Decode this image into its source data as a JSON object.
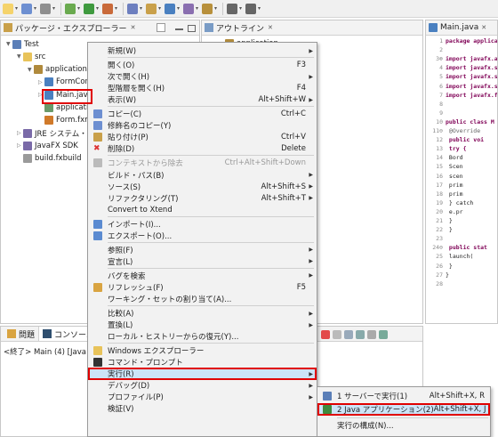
{
  "toolbar": {
    "icons": [
      "new-icon",
      "save-icon",
      "print-icon",
      "debug-icon",
      "run-icon",
      "external-tools-icon",
      "new-java-project-icon",
      "new-package-icon",
      "new-class-icon",
      "search-icon",
      "open-type-icon",
      "back-icon",
      "forward-icon"
    ]
  },
  "explorer": {
    "title": "パッケージ・エクスプローラー",
    "close": "✕",
    "tree": [
      {
        "label": "Test",
        "depth": 0,
        "twisty": "▼",
        "icon": "project"
      },
      {
        "label": "src",
        "depth": 1,
        "twisty": "▼",
        "icon": "folder"
      },
      {
        "label": "application",
        "depth": 2,
        "twisty": "▼",
        "icon": "package"
      },
      {
        "label": "FormCont",
        "depth": 3,
        "twisty": "▷",
        "icon": "java"
      },
      {
        "label": "Main.java",
        "depth": 3,
        "twisty": "▷",
        "icon": "java"
      },
      {
        "label": "applicatio",
        "depth": 3,
        "twisty": "",
        "icon": "css"
      },
      {
        "label": "Form.fxm",
        "depth": 3,
        "twisty": "",
        "icon": "fxml"
      },
      {
        "label": "JRE システム・ラ",
        "depth": 1,
        "twisty": "▷",
        "icon": "library"
      },
      {
        "label": "JavaFX SDK",
        "depth": 1,
        "twisty": "▷",
        "icon": "library"
      },
      {
        "label": "build.fxbuild",
        "depth": 1,
        "twisty": "",
        "icon": "file"
      }
    ]
  },
  "outline": {
    "title": "アウトライン",
    "close": "✕",
    "item": "application"
  },
  "editor": {
    "tab": "Main.java",
    "close": "✕",
    "lines": [
      {
        "n": "1",
        "text": "package applica"
      },
      {
        "n": "2",
        "text": ""
      },
      {
        "n": "3⊕",
        "text": "import javafx.a"
      },
      {
        "n": "4",
        "text": "import javafx.s"
      },
      {
        "n": "5",
        "text": "import javafx.s"
      },
      {
        "n": "6",
        "text": "import javafx.s"
      },
      {
        "n": "7",
        "text": "import javafx.f"
      },
      {
        "n": "8",
        "text": ""
      },
      {
        "n": "9",
        "text": ""
      },
      {
        "n": "10",
        "text": "public class M"
      },
      {
        "n": "11⊖",
        "text": "  @Override"
      },
      {
        "n": "12",
        "text": "  public voi"
      },
      {
        "n": "13",
        "text": "    try {"
      },
      {
        "n": "14",
        "text": "      Bord"
      },
      {
        "n": "15",
        "text": "      Scen"
      },
      {
        "n": "16",
        "text": "      scen"
      },
      {
        "n": "17",
        "text": "      prim"
      },
      {
        "n": "18",
        "text": "      prim"
      },
      {
        "n": "19",
        "text": "    } catch"
      },
      {
        "n": "20",
        "text": "      e.pr"
      },
      {
        "n": "21",
        "text": "    }"
      },
      {
        "n": "22",
        "text": "  }"
      },
      {
        "n": "23",
        "text": ""
      },
      {
        "n": "24⊖",
        "text": "  public stat"
      },
      {
        "n": "25",
        "text": "    launch("
      },
      {
        "n": "26",
        "text": "  }"
      },
      {
        "n": "27",
        "text": "}"
      },
      {
        "n": "28",
        "text": ""
      }
    ]
  },
  "console": {
    "tab_problems": "問題",
    "tab_console": "コンソール",
    "close": "✕",
    "line": "<終了> Main (4) [Java アプ"
  },
  "context_menu": {
    "items": [
      {
        "label": "新規(W)",
        "shortcut": "",
        "arrow": "▶",
        "icon": ""
      },
      {
        "sep": true
      },
      {
        "label": "開く(O)",
        "shortcut": "F3",
        "arrow": "",
        "icon": ""
      },
      {
        "label": "次で開く(H)",
        "shortcut": "",
        "arrow": "▶",
        "icon": ""
      },
      {
        "label": "型階層を開く(H)",
        "shortcut": "F4",
        "arrow": "",
        "icon": ""
      },
      {
        "label": "表示(W)",
        "shortcut": "Alt+Shift+W",
        "arrow": "▶",
        "icon": ""
      },
      {
        "sep": true
      },
      {
        "label": "コピー(C)",
        "shortcut": "Ctrl+C",
        "arrow": "",
        "icon": "copy"
      },
      {
        "label": "修飾名のコピー(Y)",
        "shortcut": "",
        "arrow": "",
        "icon": "copy"
      },
      {
        "label": "貼り付け(P)",
        "shortcut": "Ctrl+V",
        "arrow": "",
        "icon": "paste"
      },
      {
        "label": "削除(D)",
        "shortcut": "Delete",
        "arrow": "",
        "icon": "delete"
      },
      {
        "sep": true
      },
      {
        "label": "コンテキストから除去",
        "shortcut": "Ctrl+Alt+Shift+Down",
        "arrow": "",
        "icon": "remove",
        "disabled": true
      },
      {
        "label": "ビルド・パス(B)",
        "shortcut": "",
        "arrow": "▶",
        "icon": ""
      },
      {
        "label": "ソース(S)",
        "shortcut": "Alt+Shift+S",
        "arrow": "▶",
        "icon": ""
      },
      {
        "label": "リファクタリング(T)",
        "shortcut": "Alt+Shift+T",
        "arrow": "▶",
        "icon": ""
      },
      {
        "label": "Convert to Xtend",
        "shortcut": "",
        "arrow": "",
        "icon": ""
      },
      {
        "sep": true
      },
      {
        "label": "インポート(I)...",
        "shortcut": "",
        "arrow": "",
        "icon": "import"
      },
      {
        "label": "エクスポート(O)...",
        "shortcut": "",
        "arrow": "",
        "icon": "export"
      },
      {
        "sep": true
      },
      {
        "label": "参照(F)",
        "shortcut": "",
        "arrow": "▶",
        "icon": ""
      },
      {
        "label": "宣言(L)",
        "shortcut": "",
        "arrow": "▶",
        "icon": ""
      },
      {
        "sep": true
      },
      {
        "label": "バグを検索",
        "shortcut": "",
        "arrow": "▶",
        "icon": ""
      },
      {
        "label": "リフレッシュ(F)",
        "shortcut": "F5",
        "arrow": "",
        "icon": "refresh"
      },
      {
        "label": "ワーキング・セットの割り当て(A)...",
        "shortcut": "",
        "arrow": "",
        "icon": ""
      },
      {
        "sep": true
      },
      {
        "label": "比較(A)",
        "shortcut": "",
        "arrow": "▶",
        "icon": ""
      },
      {
        "label": "置換(L)",
        "shortcut": "",
        "arrow": "▶",
        "icon": ""
      },
      {
        "label": "ローカル・ヒストリーからの復元(Y)...",
        "shortcut": "",
        "arrow": "",
        "icon": ""
      },
      {
        "sep": true
      },
      {
        "label": "Windows エクスプローラー",
        "shortcut": "",
        "arrow": "",
        "icon": "folder"
      },
      {
        "label": "コマンド・プロンプト",
        "shortcut": "",
        "arrow": "",
        "icon": "cmd"
      },
      {
        "label": "実行(R)",
        "shortcut": "",
        "arrow": "▶",
        "icon": "",
        "highlighted": true
      },
      {
        "label": "デバッグ(D)",
        "shortcut": "",
        "arrow": "▶",
        "icon": ""
      },
      {
        "label": "プロファイル(P)",
        "shortcut": "",
        "arrow": "▶",
        "icon": ""
      },
      {
        "label": "検証(V)",
        "shortcut": "",
        "arrow": "",
        "icon": ""
      }
    ]
  },
  "submenu": {
    "items": [
      {
        "label": "1 サーバーで実行(1)",
        "shortcut": "Alt+Shift+X, R",
        "icon": "server"
      },
      {
        "label": "2 Java アプリケーション(2)",
        "shortcut": "Alt+Shift+X, J",
        "icon": "java-app",
        "highlighted": true
      },
      {
        "sep": true
      },
      {
        "label": "実行の構成(N)...",
        "shortcut": "",
        "icon": ""
      }
    ]
  },
  "colors": {
    "highlight": "#cce4f7",
    "red_annotation": "#e00000",
    "menu_bg": "#f2f2f2"
  }
}
